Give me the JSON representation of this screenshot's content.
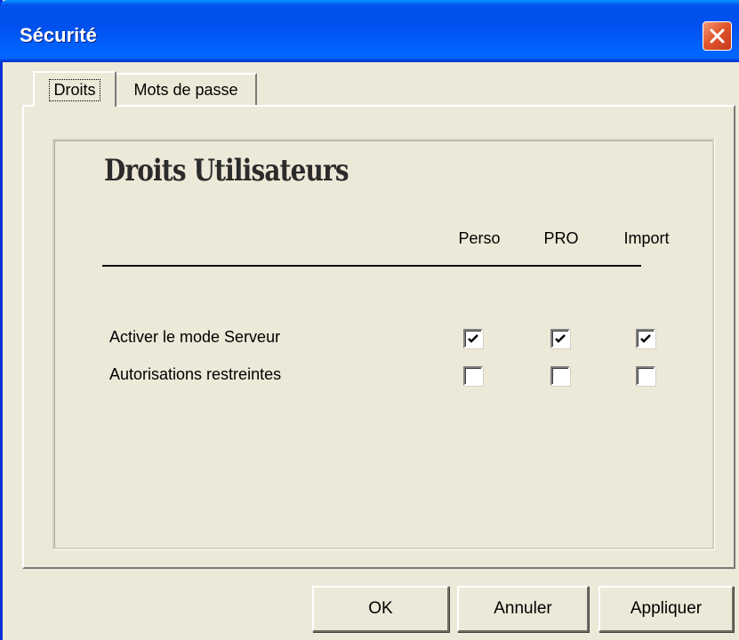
{
  "window": {
    "title": "Sécurité",
    "close_icon": "close-icon"
  },
  "tabs": [
    {
      "label": "Droits",
      "selected": true
    },
    {
      "label": "Mots de passe",
      "selected": false
    }
  ],
  "panel": {
    "heading": "Droits Utilisateurs",
    "columns": [
      "Perso",
      "PRO",
      "Import"
    ],
    "rows": [
      {
        "label": "Activer le mode Serveur",
        "checks": [
          true,
          true,
          true
        ]
      },
      {
        "label": "Autorisations restreintes",
        "checks": [
          false,
          false,
          false
        ]
      }
    ]
  },
  "buttons": {
    "ok": "OK",
    "cancel": "Annuler",
    "apply": "Appliquer"
  },
  "colors": {
    "titlebar": "#0054e3",
    "dialog_bg": "#ece9d8",
    "close_button": "#e2582e"
  }
}
